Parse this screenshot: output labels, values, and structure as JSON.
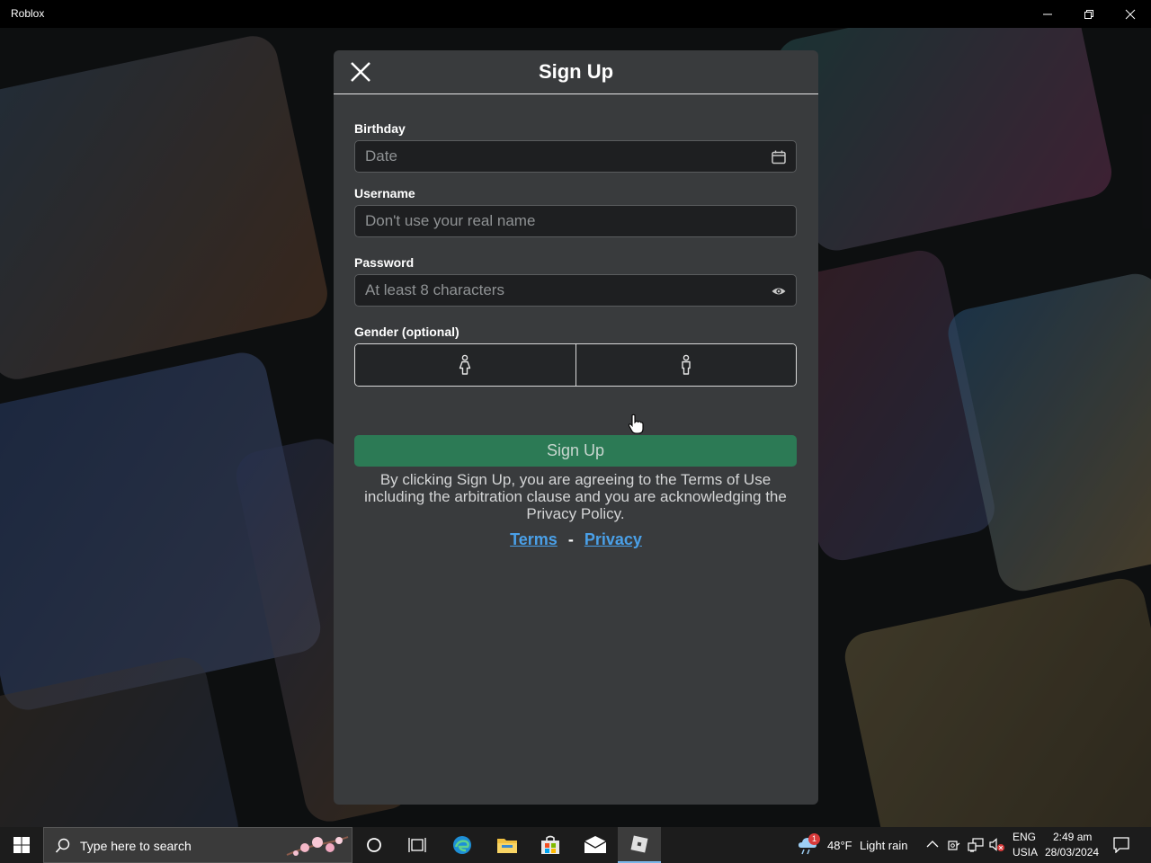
{
  "window": {
    "title": "Roblox"
  },
  "modal": {
    "title": "Sign Up",
    "birthday": {
      "label": "Birthday",
      "placeholder": "Date"
    },
    "username": {
      "label": "Username",
      "placeholder": "Don't use your real name"
    },
    "password": {
      "label": "Password",
      "placeholder": "At least 8 characters"
    },
    "gender": {
      "label": "Gender (optional)",
      "options": [
        "female-icon",
        "male-icon"
      ]
    },
    "signup_button": "Sign Up",
    "legal_text": "By clicking Sign Up, you are agreeing to the Terms of Use including the arbitration clause and you are acknowledging the Privacy Policy.",
    "terms_link": "Terms",
    "separator": "-",
    "privacy_link": "Privacy"
  },
  "taskbar": {
    "search_placeholder": "Type here to search",
    "weather_temp": "48°F",
    "weather_desc": "Light rain",
    "weather_alert": "1",
    "lang_line1": "ENG",
    "lang_line2": "USIA",
    "time": "2:49 am",
    "date": "28/03/2024"
  },
  "colors": {
    "modal_bg": "#393b3d",
    "signup_green": "#2c7a55",
    "link_blue": "#4aa0e8"
  }
}
